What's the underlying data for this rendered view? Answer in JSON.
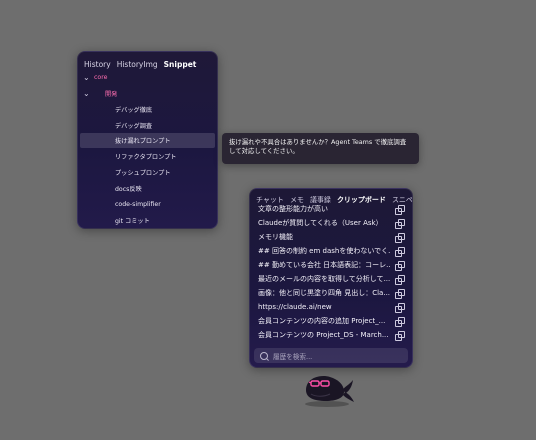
{
  "snippet_panel": {
    "tabs": [
      "History",
      "HistoryImg",
      "Snippet"
    ],
    "active_tab": "Snippet",
    "tree": [
      {
        "label": "core",
        "level": 0,
        "expanded": true
      },
      {
        "label": "開発",
        "level": 1,
        "expanded": true
      },
      {
        "label": "デバッグ徹底",
        "level": 2
      },
      {
        "label": "デバッグ調査",
        "level": 2
      },
      {
        "label": "抜け漏れプロンプト",
        "level": 2,
        "selected": true
      },
      {
        "label": "リファクタプロンプト",
        "level": 2
      },
      {
        "label": "プッシュプロンプト",
        "level": 2
      },
      {
        "label": "docs反映",
        "level": 2
      },
      {
        "label": "code-simplifier",
        "level": 2
      },
      {
        "label": "git コミット",
        "level": 2
      }
    ]
  },
  "tooltip": {
    "line1": "抜け漏れや不具合はありませんか？Agent Teams で徹底調査",
    "line2": "して対応してください。"
  },
  "clipboard_panel": {
    "tabs": [
      "チャット",
      "メモ",
      "議事録",
      "クリップボード",
      "スニペ"
    ],
    "active_tab": "クリップボード",
    "items": [
      "文章の整形能力が高い",
      "Claudeが質問してくれる（User Ask）",
      "メモリ機能",
      "## 回答の制約 em dashを使わないでく...",
      "## 勤めている会社 日本語表記：コーレ...",
      "最近のメールの内容を取得して分析して...",
      "画像：他と同じ黒塗り四角 見出し：Cla...",
      "https://claude.ai/new",
      "会員コンテンツの内容の追加 Project_...",
      "会員コンテンツの Project_DS - March..."
    ],
    "search_placeholder": "履歴を検索..."
  },
  "colors": {
    "background": "#6e6e6e",
    "panel": "#1e1840",
    "accent_pink": "#ff6fb0"
  }
}
